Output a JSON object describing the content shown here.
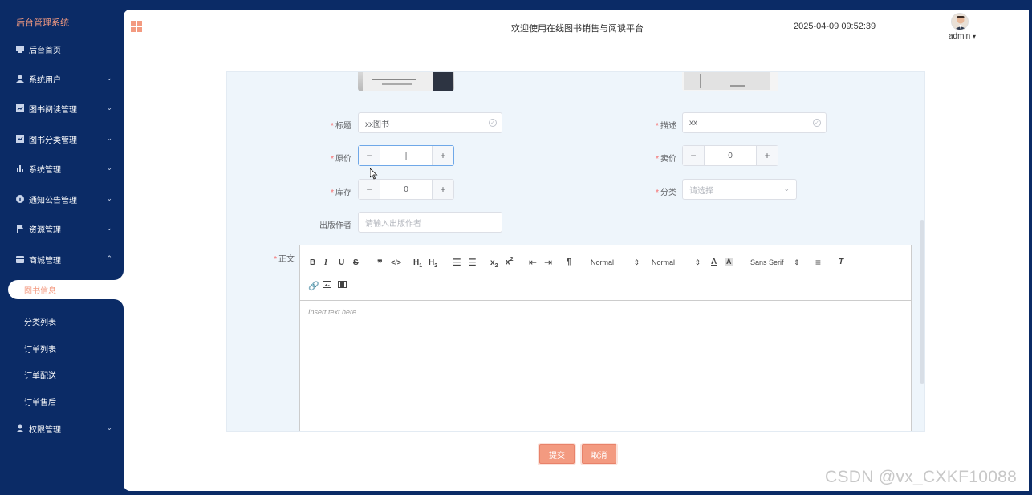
{
  "sidebar": {
    "title": "后台管理系统",
    "items": [
      {
        "label": "后台首页",
        "icon": "monitor-icon"
      },
      {
        "label": "系统用户",
        "icon": "user-icon"
      },
      {
        "label": "图书阅读管理",
        "icon": "chart-box-icon"
      },
      {
        "label": "图书分类管理",
        "icon": "chart-box-icon"
      },
      {
        "label": "系统管理",
        "icon": "bar-chart-icon"
      },
      {
        "label": "通知公告管理",
        "icon": "info-icon"
      },
      {
        "label": "资源管理",
        "icon": "flag-icon"
      },
      {
        "label": "商城管理",
        "icon": "card-icon"
      },
      {
        "label": "权限管理",
        "icon": "user-icon"
      }
    ],
    "sub_items": [
      {
        "label": "图书信息",
        "active": true
      },
      {
        "label": "分类列表"
      },
      {
        "label": "订单列表"
      },
      {
        "label": "订单配送"
      },
      {
        "label": "订单售后"
      }
    ]
  },
  "header": {
    "welcome": "欢迎使用在线图书销售与阅读平台",
    "datetime": "2025-04-09 09:52:39",
    "user": "admin"
  },
  "form": {
    "title_label": "标题",
    "title_value": "xx图书",
    "desc_label": "描述",
    "desc_value": "xx",
    "orig_price_label": "原价",
    "orig_price_value": "|",
    "sale_price_label": "卖价",
    "sale_price_value": "0",
    "stock_label": "库存",
    "stock_value": "0",
    "category_label": "分类",
    "category_placeholder": "请选择",
    "author_label": "出版作者",
    "author_placeholder": "请输入出版作者",
    "content_label": "正文",
    "editor_placeholder": "Insert text here ...",
    "header_select": "Normal",
    "size_select": "Normal",
    "font_select": "Sans Serif"
  },
  "actions": {
    "submit": "提交",
    "cancel": "取消"
  },
  "watermark": "CSDN @vx_CXKF10088",
  "colors": {
    "sidebar_bg": "#0b2b66",
    "accent": "#f39a80"
  }
}
